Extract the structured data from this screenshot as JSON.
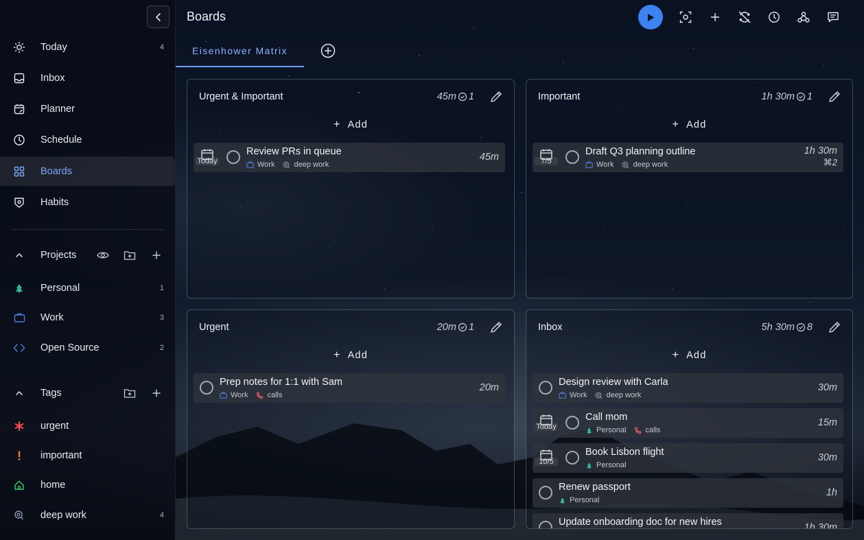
{
  "header": {
    "title": "Boards"
  },
  "tabs": {
    "active": "Eisenhower Matrix"
  },
  "sidebar": {
    "nav": [
      {
        "label": "Today",
        "count": "4",
        "icon": "sun-icon"
      },
      {
        "label": "Inbox",
        "count": "",
        "icon": "inbox-icon"
      },
      {
        "label": "Planner",
        "count": "",
        "icon": "calendar-edit-icon"
      },
      {
        "label": "Schedule",
        "count": "",
        "icon": "clock-icon"
      },
      {
        "label": "Boards",
        "count": "",
        "icon": "grid-icon"
      },
      {
        "label": "Habits",
        "count": "",
        "icon": "habit-icon"
      }
    ],
    "projects_title": "Projects",
    "projects": [
      {
        "label": "Personal",
        "count": "1"
      },
      {
        "label": "Work",
        "count": "3"
      },
      {
        "label": "Open Source",
        "count": "2"
      }
    ],
    "tags_title": "Tags",
    "tags": [
      {
        "label": "urgent",
        "count": ""
      },
      {
        "label": "important",
        "count": ""
      },
      {
        "label": "home",
        "count": ""
      },
      {
        "label": "deep work",
        "count": "4"
      }
    ]
  },
  "colors": {
    "accent": "#3c82f0",
    "active_text": "#7ea6ff",
    "urgent": "#ff4d4f",
    "important": "#ff5a4f",
    "home": "#3cc76a",
    "work": "#4b7bd8",
    "personal": "#2fb8a0",
    "calls": "#ff5a6a"
  },
  "add_label": "Add",
  "quadrants": [
    {
      "title": "Urgent & Important",
      "meta_time": "45m",
      "meta_count": "1",
      "tasks": [
        {
          "date": "Today",
          "name": "Review PRs in queue",
          "project": "Work",
          "tag": "deep work",
          "duration": "45m"
        }
      ]
    },
    {
      "title": "Important",
      "meta_time": "1h 30m",
      "meta_count": "1",
      "tasks": [
        {
          "date": "7/5",
          "name": "Draft Q3 planning outline",
          "project": "Work",
          "tag": "deep work",
          "duration": "1h 30m",
          "subtasks": "2"
        }
      ]
    },
    {
      "title": "Urgent",
      "meta_time": "20m",
      "meta_count": "1",
      "tasks": [
        {
          "date": "",
          "name": "Prep notes for 1:1 with Sam",
          "project": "Work",
          "tag": "calls",
          "duration": "20m"
        }
      ]
    },
    {
      "title": "Inbox",
      "meta_time": "5h 30m",
      "meta_count": "8",
      "tasks": [
        {
          "date": "",
          "name": "Design review with Carla",
          "project": "Work",
          "tag": "deep work",
          "duration": "30m"
        },
        {
          "date": "Today",
          "name": "Call mom",
          "project": "Personal",
          "tag": "calls",
          "duration": "15m"
        },
        {
          "date": "10/5",
          "name": "Book Lisbon flight",
          "project": "Personal",
          "tag": "",
          "duration": "30m"
        },
        {
          "date": "",
          "name": "Renew passport",
          "project": "Personal",
          "tag": "",
          "duration": "1h"
        },
        {
          "date": "",
          "name": "Update onboarding doc for new hires",
          "project": "",
          "tag": "",
          "duration": "1h 30m"
        }
      ]
    }
  ]
}
